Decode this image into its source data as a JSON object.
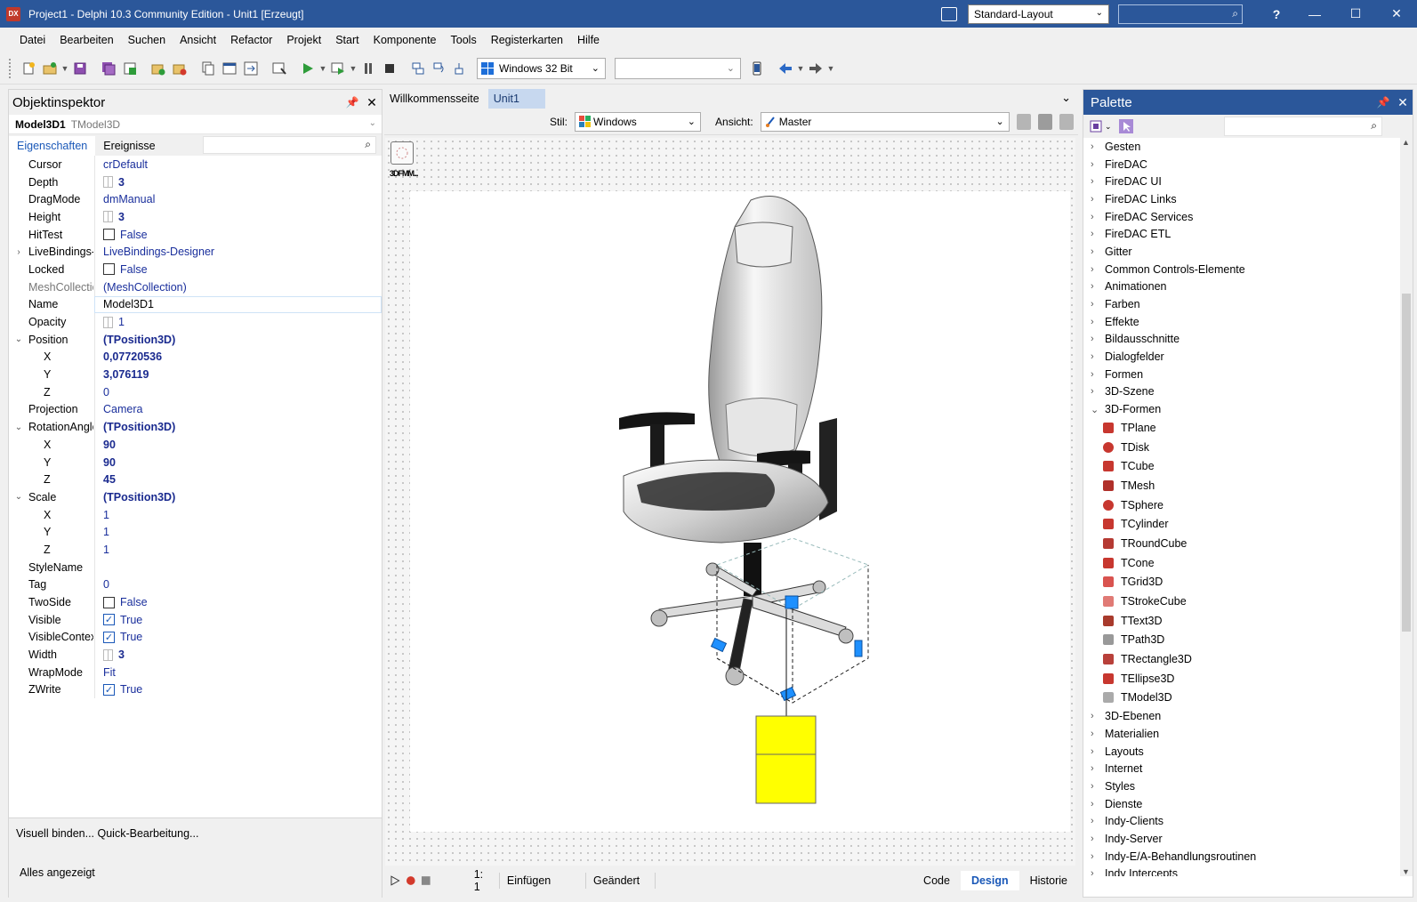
{
  "window": {
    "title": "Project1 - Delphi 10.3 Community Edition - Unit1 [Erzeugt]",
    "app_icon_text": "DX",
    "layout_select": "Standard-Layout",
    "help": "?"
  },
  "menu": [
    "Datei",
    "Bearbeiten",
    "Suchen",
    "Ansicht",
    "Refactor",
    "Projekt",
    "Start",
    "Komponente",
    "Tools",
    "Registerkarten",
    "Hilfe"
  ],
  "toolbar": {
    "platform": "Windows 32 Bit"
  },
  "object_inspector": {
    "title": "Objektinspektor",
    "component_name": "Model3D1",
    "component_class": "TModel3D",
    "tabs": [
      "Eigenschaften",
      "Ereignisse"
    ],
    "properties": [
      {
        "name": "Cursor",
        "value": "crDefault",
        "kind": "text",
        "indent": 0,
        "exp": ""
      },
      {
        "name": "Depth",
        "value": "3",
        "kind": "spin",
        "indent": 0,
        "exp": "",
        "bold": true
      },
      {
        "name": "DragMode",
        "value": "dmManual",
        "kind": "text",
        "indent": 0,
        "exp": ""
      },
      {
        "name": "Height",
        "value": "3",
        "kind": "spin",
        "indent": 0,
        "exp": "",
        "bold": true
      },
      {
        "name": "HitTest",
        "value": "False",
        "kind": "check",
        "checked": false,
        "indent": 0,
        "exp": ""
      },
      {
        "name": "LiveBindings-",
        "value": "LiveBindings-Designer",
        "kind": "text",
        "indent": 0,
        "exp": "›"
      },
      {
        "name": "Locked",
        "value": "False",
        "kind": "check",
        "checked": false,
        "indent": 0,
        "exp": ""
      },
      {
        "name": "MeshCollectio",
        "value": "(MeshCollection)",
        "kind": "text",
        "indent": 0,
        "exp": "",
        "grey": true
      },
      {
        "name": "Name",
        "value": "Model3D1",
        "kind": "text",
        "indent": 0,
        "exp": "",
        "selected": true
      },
      {
        "name": "Opacity",
        "value": "1",
        "kind": "spin",
        "indent": 0,
        "exp": ""
      },
      {
        "name": "Position",
        "value": "(TPosition3D)",
        "kind": "text",
        "indent": 0,
        "exp": "⌄",
        "bold": true
      },
      {
        "name": "X",
        "value": "0,07720536",
        "kind": "text",
        "indent": 1,
        "exp": "",
        "bold": true
      },
      {
        "name": "Y",
        "value": "3,076119",
        "kind": "text",
        "indent": 1,
        "exp": "",
        "bold": true
      },
      {
        "name": "Z",
        "value": "0",
        "kind": "text",
        "indent": 1,
        "exp": ""
      },
      {
        "name": "Projection",
        "value": "Camera",
        "kind": "text",
        "indent": 0,
        "exp": ""
      },
      {
        "name": "RotationAngle",
        "value": "(TPosition3D)",
        "kind": "text",
        "indent": 0,
        "exp": "⌄",
        "bold": true
      },
      {
        "name": "X",
        "value": "90",
        "kind": "text",
        "indent": 1,
        "exp": "",
        "bold": true
      },
      {
        "name": "Y",
        "value": "90",
        "kind": "text",
        "indent": 1,
        "exp": "",
        "bold": true
      },
      {
        "name": "Z",
        "value": "45",
        "kind": "text",
        "indent": 1,
        "exp": "",
        "bold": true
      },
      {
        "name": "Scale",
        "value": "(TPosition3D)",
        "kind": "text",
        "indent": 0,
        "exp": "⌄",
        "bold": true
      },
      {
        "name": "X",
        "value": "1",
        "kind": "text",
        "indent": 1,
        "exp": ""
      },
      {
        "name": "Y",
        "value": "1",
        "kind": "text",
        "indent": 1,
        "exp": ""
      },
      {
        "name": "Z",
        "value": "1",
        "kind": "text",
        "indent": 1,
        "exp": ""
      },
      {
        "name": "StyleName",
        "value": "",
        "kind": "text",
        "indent": 0,
        "exp": ""
      },
      {
        "name": "Tag",
        "value": "0",
        "kind": "text",
        "indent": 0,
        "exp": ""
      },
      {
        "name": "TwoSide",
        "value": "False",
        "kind": "check",
        "checked": false,
        "indent": 0,
        "exp": ""
      },
      {
        "name": "Visible",
        "value": "True",
        "kind": "check",
        "checked": true,
        "indent": 0,
        "exp": ""
      },
      {
        "name": "VisibleContex",
        "value": "True",
        "kind": "check",
        "checked": true,
        "indent": 0,
        "exp": ""
      },
      {
        "name": "Width",
        "value": "3",
        "kind": "spin",
        "indent": 0,
        "exp": "",
        "bold": true
      },
      {
        "name": "WrapMode",
        "value": "Fit",
        "kind": "text",
        "indent": 0,
        "exp": ""
      },
      {
        "name": "ZWrite",
        "value": "True",
        "kind": "check",
        "checked": true,
        "indent": 0,
        "exp": ""
      }
    ],
    "footer_links": "Visuell binden...  Quick-Bearbeitung...",
    "status": "Alles angezeigt"
  },
  "editor": {
    "tabs": [
      "Willkommensseite",
      "Unit1"
    ],
    "style_label": "Stil:",
    "style_value": "Windows",
    "view_label": "Ansicht:",
    "view_value": "Master",
    "nonvisual_label": "3DFMM...",
    "status": {
      "position": "1:   1",
      "mode": "Einfügen",
      "state": "Geändert",
      "views": [
        "Code",
        "Design",
        "Historie"
      ],
      "active_view": "Design"
    }
  },
  "palette": {
    "title": "Palette",
    "categories_before": [
      "Gesten",
      "FireDAC",
      "FireDAC UI",
      "FireDAC Links",
      "FireDAC Services",
      "FireDAC ETL",
      "Gitter",
      "Common Controls-Elemente",
      "Animationen",
      "Farben",
      "Effekte",
      "Bildausschnitte",
      "Dialogfelder",
      "Formen",
      "3D-Szene"
    ],
    "open_category": "3D-Formen",
    "components": [
      "TPlane",
      "TDisk",
      "TCube",
      "TMesh",
      "TSphere",
      "TCylinder",
      "TRoundCube",
      "TCone",
      "TGrid3D",
      "TStrokeCube",
      "TText3D",
      "TPath3D",
      "TRectangle3D",
      "TEllipse3D",
      "TModel3D"
    ],
    "categories_after": [
      "3D-Ebenen",
      "Materialien",
      "Layouts",
      "Internet",
      "Styles",
      "Dienste",
      "Indy-Clients",
      "Indy-Server",
      "Indy-E/A-Behandlungsroutinen",
      "Indy Intercepts"
    ]
  },
  "colors": {
    "accent": "#2b579a",
    "selection_blue": "#1a58b8",
    "cube_yellow": "#ffff00",
    "gizmo_blue": "#1e90ff"
  }
}
